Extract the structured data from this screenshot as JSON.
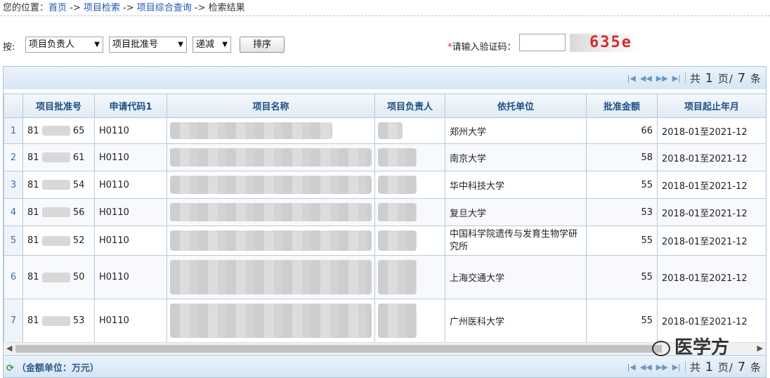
{
  "breadcrumb": {
    "prefix": "您的位置：",
    "home": "首页",
    "sep1": " -> ",
    "search": "项目检索",
    "sep2": " -> ",
    "query": "项目综合查询",
    "sep3": " -> ",
    "current": "检索结果"
  },
  "sort": {
    "label": "按:",
    "field1": "项目负责人",
    "field2": "项目批准号",
    "order": "递减",
    "button": "排序"
  },
  "captcha": {
    "required_mark": "*",
    "label": "请输入验证码：",
    "input_value": "",
    "code": "635e"
  },
  "pager": {
    "text_prefix": "共",
    "current_page": "1",
    "page_unit": "页/",
    "total": "7",
    "total_unit": "条"
  },
  "unit_note": "（金额单位：万元）",
  "table": {
    "headers": [
      "",
      "项目批准号",
      "申请代码1",
      "项目名称",
      "项目负责人",
      "依托单位",
      "批准金额",
      "项目起止年月"
    ],
    "rows": [
      {
        "idx": "1",
        "id_a": "81",
        "id_b": "65",
        "code": "H0110",
        "org": "郑州大学",
        "amount": "66",
        "period": "2018-01至2021-12"
      },
      {
        "idx": "2",
        "id_a": "81",
        "id_b": "61",
        "code": "H0110",
        "org": "南京大学",
        "amount": "58",
        "period": "2018-01至2021-12"
      },
      {
        "idx": "3",
        "id_a": "81",
        "id_b": "54",
        "code": "H0110",
        "org": "华中科技大学",
        "amount": "55",
        "period": "2018-01至2021-12"
      },
      {
        "idx": "4",
        "id_a": "81",
        "id_b": "56",
        "code": "H0110",
        "org": "复旦大学",
        "amount": "53",
        "period": "2018-01至2021-12"
      },
      {
        "idx": "5",
        "id_a": "81",
        "id_b": "52",
        "code": "H0110",
        "org": "中国科学院遗传与发育生物学研究所",
        "amount": "55",
        "period": "2018-01至2021-12"
      },
      {
        "idx": "6",
        "id_a": "81",
        "id_b": "50",
        "code": "H0110",
        "org": "上海交通大学",
        "amount": "55",
        "period": "2018-01至2021-12"
      },
      {
        "idx": "7",
        "id_a": "81",
        "id_b": "53",
        "code": "H0110",
        "org": "广州医科大学",
        "amount": "55",
        "period": "2018-01至2021-12"
      }
    ]
  },
  "watermark": "医学方",
  "icons": {
    "first": "first-page-icon",
    "prev": "prev-page-icon",
    "next": "next-page-icon",
    "last": "last-page-icon",
    "refresh": "refresh-icon"
  }
}
